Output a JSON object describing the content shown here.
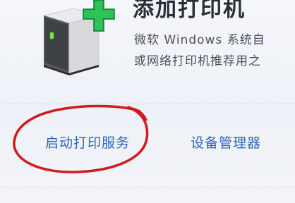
{
  "panel": {
    "title": "添加打印机",
    "description_line1": "微软 Windows 系统自",
    "description_line2": "或网络打印机推荐用之"
  },
  "links": {
    "start_print_service": "启动打印服务",
    "device_manager": "设备管理器"
  },
  "icons": {
    "printer": "printer-tower-icon",
    "add": "plus-icon"
  },
  "colors": {
    "link": "#2f63c0",
    "plus": "#22b24c",
    "annotation": "#d11a1a"
  }
}
